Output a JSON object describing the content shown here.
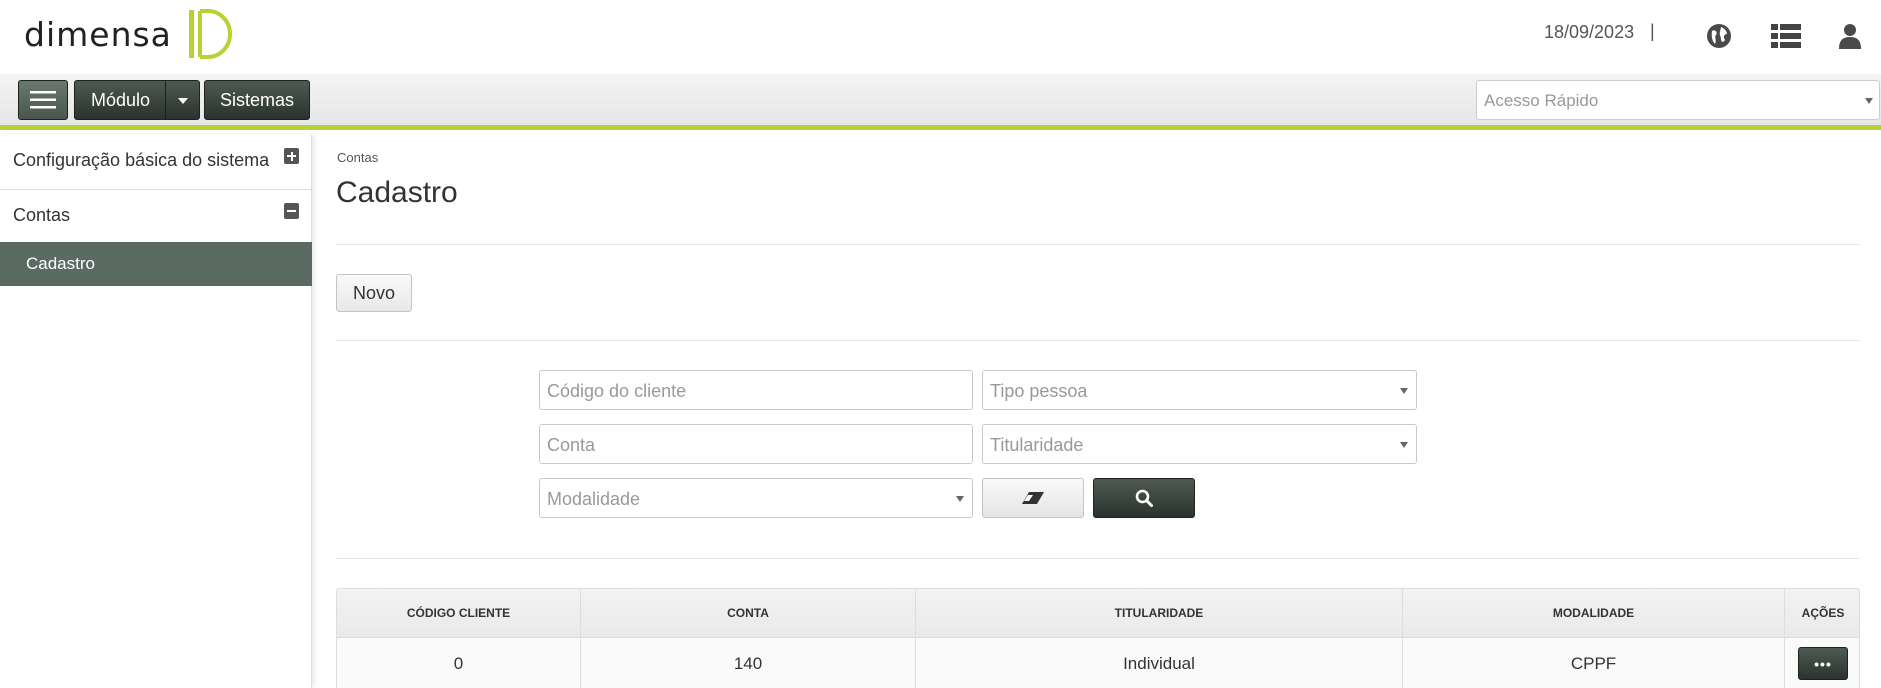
{
  "header": {
    "logo_text": "DIMENSA",
    "date": "18/09/2023",
    "date_separator": "|",
    "icons": [
      "globe-icon",
      "list-icon",
      "user-icon"
    ]
  },
  "toolbar": {
    "menu_icon": "hamburger-icon",
    "modulo_label": "Módulo",
    "sistemas_label": "Sistemas",
    "quick_access_placeholder": "Acesso Rápido"
  },
  "sidebar": {
    "items": [
      {
        "label": "Configuração básica do sistema",
        "state": "collapsed"
      },
      {
        "label": "Contas",
        "state": "expanded"
      }
    ],
    "active_sub_item": "Cadastro"
  },
  "main": {
    "breadcrumb": "Contas",
    "title": "Cadastro",
    "novo_label": "Novo",
    "filters": {
      "codigo_cliente_placeholder": "Código do cliente",
      "tipo_pessoa_placeholder": "Tipo pessoa",
      "conta_placeholder": "Conta",
      "titularidade_placeholder": "Titularidade",
      "modalidade_placeholder": "Modalidade"
    }
  },
  "table": {
    "columns": [
      "CÓDIGO CLIENTE",
      "CONTA",
      "TITULARIDADE",
      "MODALIDADE",
      "AÇÕES"
    ],
    "rows": [
      {
        "codigo_cliente": "0",
        "conta": "140",
        "titularidade": "Individual",
        "modalidade": "CPPF",
        "acoes": "•••"
      }
    ]
  },
  "colors": {
    "accent": "#b5d334",
    "dark_button": "#2f3833",
    "sidebar_active": "#5b6a62"
  }
}
